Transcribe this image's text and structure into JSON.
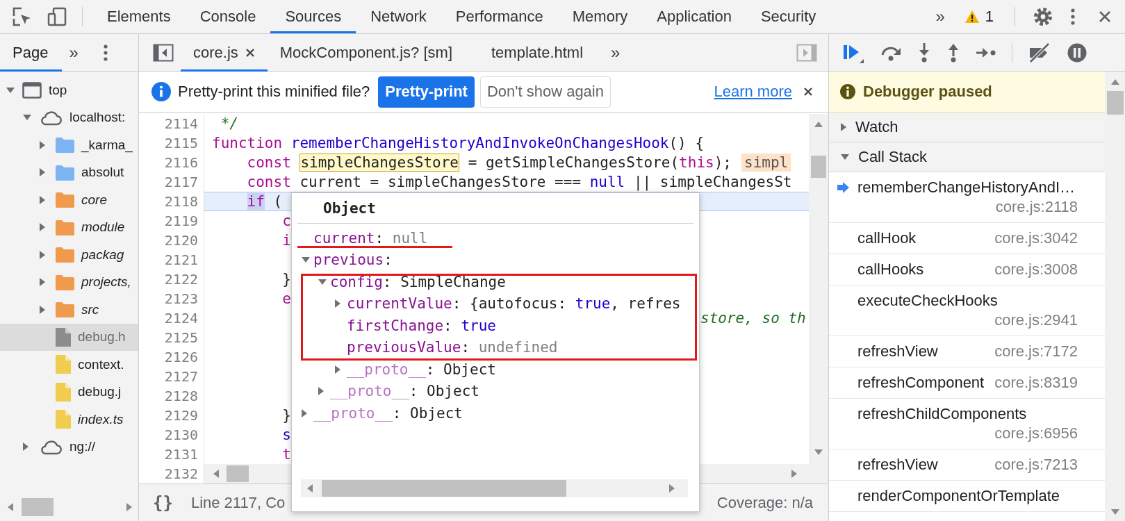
{
  "toolbar": {
    "tabs": [
      {
        "label": "Elements",
        "selected": false
      },
      {
        "label": "Console",
        "selected": false
      },
      {
        "label": "Sources",
        "selected": true
      },
      {
        "label": "Network",
        "selected": false
      },
      {
        "label": "Performance",
        "selected": false
      },
      {
        "label": "Memory",
        "selected": false
      },
      {
        "label": "Application",
        "selected": false
      },
      {
        "label": "Security",
        "selected": false
      }
    ],
    "overflow": "»",
    "warnings": "1"
  },
  "navigator": {
    "tabs": [
      {
        "label": "Page",
        "selected": true
      }
    ],
    "overflow": "»",
    "tree": [
      {
        "kind": "frame",
        "label": "top",
        "expanded": true,
        "selected": false,
        "italic": false,
        "children": [
          {
            "kind": "domain",
            "label": "localhost:",
            "expanded": true,
            "selected": false,
            "italic": false,
            "children": [
              {
                "kind": "folder",
                "label": "_karma_",
                "color": "#7cb4f2",
                "expanded": false,
                "selected": false,
                "italic": false
              },
              {
                "kind": "folder",
                "label": "absolut",
                "color": "#7cb4f2",
                "expanded": false,
                "selected": false,
                "italic": false
              },
              {
                "kind": "folder",
                "label": "core",
                "color": "#ef9a4c",
                "expanded": false,
                "selected": false,
                "italic": true
              },
              {
                "kind": "folder",
                "label": "module",
                "color": "#ef9a4c",
                "expanded": false,
                "selected": false,
                "italic": true
              },
              {
                "kind": "folder",
                "label": "packag",
                "color": "#ef9a4c",
                "expanded": false,
                "selected": false,
                "italic": true
              },
              {
                "kind": "folder",
                "label": "projects,",
                "color": "#ef9a4c",
                "expanded": false,
                "selected": false,
                "italic": true
              },
              {
                "kind": "folder",
                "label": "src",
                "color": "#ef9a4c",
                "expanded": false,
                "selected": false,
                "italic": true
              },
              {
                "kind": "file",
                "label": "debug.h",
                "color": "#8c8c8c",
                "selected": true,
                "italic": false
              },
              {
                "kind": "file",
                "label": "context.",
                "color": "#f0cc4f",
                "selected": false,
                "italic": false
              },
              {
                "kind": "file",
                "label": "debug.j",
                "color": "#f0cc4f",
                "selected": false,
                "italic": false
              },
              {
                "kind": "file",
                "label": "index.ts",
                "color": "#f0cc4f",
                "selected": false,
                "italic": true
              }
            ]
          },
          {
            "kind": "domain",
            "label": "ng://",
            "expanded": false,
            "selected": false,
            "italic": false
          }
        ]
      }
    ]
  },
  "editor": {
    "tabs": [
      {
        "label": "core.js",
        "selected": true,
        "closable": true
      },
      {
        "label": "MockComponent.js? [sm]",
        "selected": false,
        "closable": false
      },
      {
        "label": "template.html",
        "selected": false,
        "closable": false
      }
    ],
    "overflow": "»",
    "infobar": {
      "message": "Pretty-print this minified file?",
      "buttons": [
        {
          "label": "Pretty-print",
          "primary": true
        },
        {
          "label": "Don't show again",
          "primary": false
        }
      ],
      "link": "Learn more"
    },
    "lines": [
      {
        "number": "2114",
        "segments": [
          {
            "kind": "comment",
            "text": " */"
          }
        ]
      },
      {
        "number": "2115",
        "segments": [
          {
            "kind": "keyword",
            "text": "function"
          },
          {
            "kind": "def",
            "text": " rememberChangeHistoryAndInvokeOnChangesHook"
          },
          {
            "kind": "plain",
            "text": "() {"
          }
        ]
      },
      {
        "number": "2116",
        "segments": [
          {
            "kind": "keyword",
            "text": "    const "
          },
          {
            "kind": "hover-variable",
            "text": "simpleChangesStore"
          },
          {
            "kind": "plain",
            "text": " = getSimpleChangesStore("
          },
          {
            "kind": "keyword",
            "text": "this"
          },
          {
            "kind": "plain",
            "text": ");"
          },
          {
            "kind": "inline-value",
            "text": "simpl"
          }
        ]
      },
      {
        "number": "2117",
        "segments": [
          {
            "kind": "keyword",
            "text": "    const"
          },
          {
            "kind": "plain",
            "text": " current = simpleChangesStore === "
          },
          {
            "kind": "atom",
            "text": "null"
          },
          {
            "kind": "plain",
            "text": " || simpleChangesSt"
          }
        ]
      },
      {
        "number": "2118",
        "paused": true,
        "segments": [
          {
            "kind": "keyword-selected",
            "text": "    if"
          },
          {
            "kind": "plain",
            "text": " ("
          }
        ]
      },
      {
        "number": "2119",
        "segments": [
          {
            "kind": "keyword",
            "text": "        c"
          }
        ]
      },
      {
        "number": "2120",
        "segments": [
          {
            "kind": "keyword",
            "text": "        i"
          }
        ]
      },
      {
        "number": "2121"
      },
      {
        "number": "2122",
        "segments": [
          {
            "kind": "plain",
            "text": "        }"
          }
        ]
      },
      {
        "number": "2123",
        "segments": [
          {
            "kind": "keyword",
            "text": "        e"
          }
        ]
      },
      {
        "number": "2124",
        "right_of_popover": [
          {
            "kind": "comment",
            "text": "store, so th"
          }
        ]
      },
      {
        "number": "2125"
      },
      {
        "number": "2126"
      },
      {
        "number": "2127"
      },
      {
        "number": "2128"
      },
      {
        "number": "2129",
        "segments": [
          {
            "kind": "plain",
            "text": "        }"
          }
        ]
      },
      {
        "number": "2130",
        "segments": [
          {
            "kind": "def",
            "text": "        s"
          }
        ]
      },
      {
        "number": "2131",
        "segments": [
          {
            "kind": "keyword",
            "text": "        t"
          }
        ]
      },
      {
        "number": "2132"
      }
    ],
    "status": {
      "format_button": "{}",
      "position": "Line 2117, Co",
      "coverage": "Coverage: n/a"
    }
  },
  "popover": {
    "title": "Object",
    "rows": [
      {
        "segments": [
          {
            "kind": "key",
            "text": "current"
          },
          {
            "kind": "plain",
            "text": ": "
          },
          {
            "kind": "null",
            "text": "null"
          }
        ]
      },
      {
        "expanded": true,
        "segments": [
          {
            "kind": "key",
            "text": "previous"
          },
          {
            "kind": "plain",
            "text": ":"
          }
        ],
        "children": [
          {
            "expanded": true,
            "segments": [
              {
                "kind": "key",
                "text": "config"
              },
              {
                "kind": "plain",
                "text": ": SimpleChange"
              }
            ],
            "children": [
              {
                "expanded": false,
                "segments": [
                  {
                    "kind": "key",
                    "text": "currentValue"
                  },
                  {
                    "kind": "plain",
                    "text": ": {autofocus: "
                  },
                  {
                    "kind": "boolean",
                    "text": "true"
                  },
                  {
                    "kind": "plain",
                    "text": ", refres"
                  }
                ]
              },
              {
                "segments": [
                  {
                    "kind": "key",
                    "text": "firstChange"
                  },
                  {
                    "kind": "plain",
                    "text": ": "
                  },
                  {
                    "kind": "boolean",
                    "text": "true"
                  }
                ]
              },
              {
                "segments": [
                  {
                    "kind": "key",
                    "text": "previousValue"
                  },
                  {
                    "kind": "plain",
                    "text": ": "
                  },
                  {
                    "kind": "undefined",
                    "text": "undefined"
                  }
                ]
              },
              {
                "expanded": false,
                "segments": [
                  {
                    "kind": "internal-key",
                    "text": "__proto__"
                  },
                  {
                    "kind": "plain",
                    "text": ": Object"
                  }
                ]
              }
            ]
          },
          {
            "expanded": false,
            "segments": [
              {
                "kind": "internal-key",
                "text": "__proto__"
              },
              {
                "kind": "plain",
                "text": ": Object"
              }
            ]
          }
        ]
      },
      {
        "expanded": false,
        "segments": [
          {
            "kind": "internal-key",
            "text": "__proto__"
          },
          {
            "kind": "plain",
            "text": ": Object"
          }
        ]
      }
    ],
    "annotations": [
      {
        "kind": "underline"
      },
      {
        "kind": "frame"
      }
    ]
  },
  "debugger": {
    "banner": "Debugger paused",
    "sections": [
      {
        "title": "Watch",
        "expanded": false
      },
      {
        "title": "Call Stack",
        "expanded": true,
        "frames": [
          {
            "name": "rememberChangeHistoryAndI…",
            "location": "core.js:2118",
            "selected": true
          },
          {
            "name": "callHook",
            "location": "core.js:3042",
            "selected": false
          },
          {
            "name": "callHooks",
            "location": "core.js:3008",
            "selected": false
          },
          {
            "name": "executeCheckHooks",
            "location": "core.js:2941",
            "selected": false
          },
          {
            "name": "refreshView",
            "location": "core.js:7172",
            "selected": false
          },
          {
            "name": "refreshComponent",
            "location": "core.js:8319",
            "selected": false
          },
          {
            "name": "refreshChildComponents",
            "location": "core.js:6956",
            "selected": false
          },
          {
            "name": "refreshView",
            "location": "core.js:7213",
            "selected": false
          },
          {
            "name": "renderComponentOrTemplate",
            "selected": false
          }
        ]
      }
    ]
  }
}
